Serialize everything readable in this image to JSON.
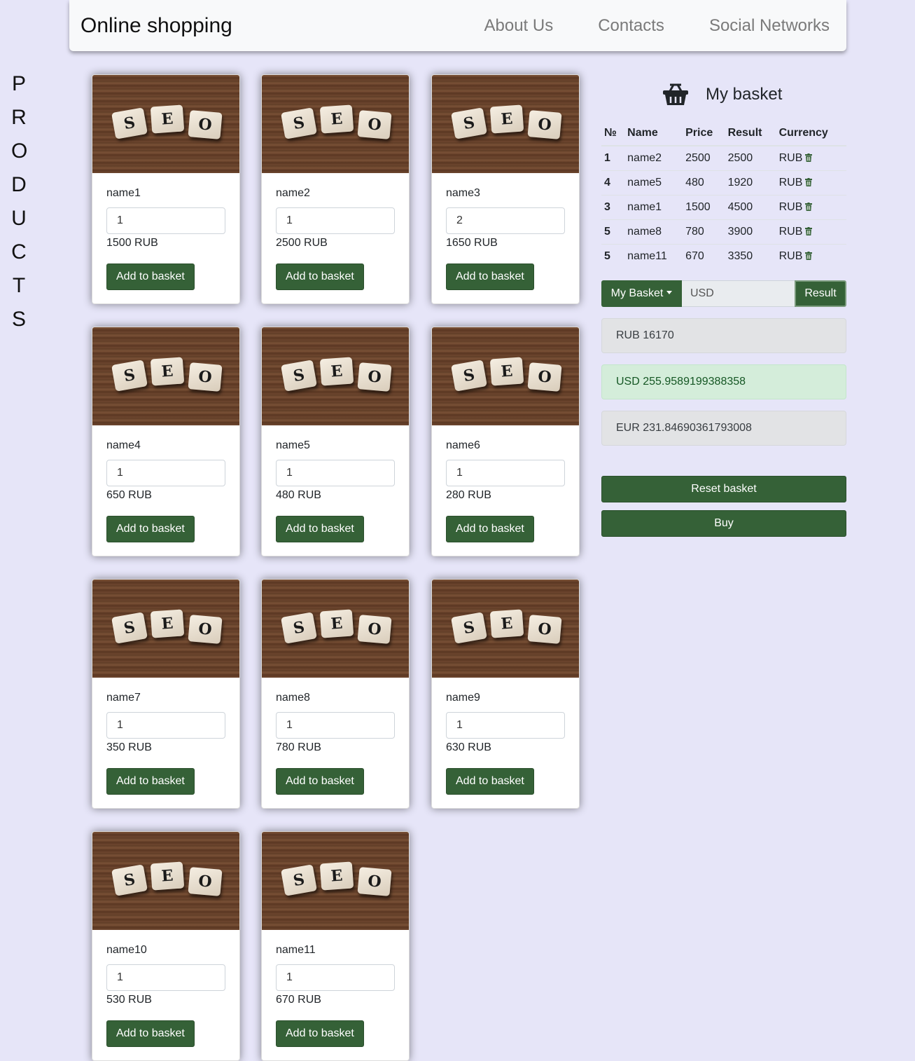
{
  "navbar": {
    "brand": "Online shopping",
    "links": [
      "About Us",
      "Contacts",
      "Social Networks"
    ]
  },
  "sidebar_title_letters": [
    "P",
    "R",
    "O",
    "D",
    "U",
    "C",
    "T",
    "S"
  ],
  "image_tiles": [
    "S",
    "E",
    "O"
  ],
  "products": [
    {
      "name": "name1",
      "qty": "1",
      "price": "1500 RUB",
      "button": "Add to basket"
    },
    {
      "name": "name2",
      "qty": "1",
      "price": "2500 RUB",
      "button": "Add to basket"
    },
    {
      "name": "name3",
      "qty": "2",
      "price": "1650 RUB",
      "button": "Add to basket"
    },
    {
      "name": "name4",
      "qty": "1",
      "price": "650 RUB",
      "button": "Add to basket"
    },
    {
      "name": "name5",
      "qty": "1",
      "price": "480 RUB",
      "button": "Add to basket"
    },
    {
      "name": "name6",
      "qty": "1",
      "price": "280 RUB",
      "button": "Add to basket"
    },
    {
      "name": "name7",
      "qty": "1",
      "price": "350 RUB",
      "button": "Add to basket"
    },
    {
      "name": "name8",
      "qty": "1",
      "price": "780 RUB",
      "button": "Add to basket"
    },
    {
      "name": "name9",
      "qty": "1",
      "price": "630 RUB",
      "button": "Add to basket"
    },
    {
      "name": "name10",
      "qty": "1",
      "price": "530 RUB",
      "button": "Add to basket"
    },
    {
      "name": "name11",
      "qty": "1",
      "price": "670 RUB",
      "button": "Add to basket"
    }
  ],
  "basket": {
    "title": "My basket",
    "icon": "basket-icon",
    "columns": [
      "№",
      "Name",
      "Price",
      "Result",
      "Currency"
    ],
    "rows": [
      {
        "num": "1",
        "name": "name2",
        "price": "2500",
        "result": "2500",
        "currency": "RUB"
      },
      {
        "num": "4",
        "name": "name5",
        "price": "480",
        "result": "1920",
        "currency": "RUB"
      },
      {
        "num": "3",
        "name": "name1",
        "price": "1500",
        "result": "4500",
        "currency": "RUB"
      },
      {
        "num": "5",
        "name": "name8",
        "price": "780",
        "result": "3900",
        "currency": "RUB"
      },
      {
        "num": "5",
        "name": "name11",
        "price": "670",
        "result": "3350",
        "currency": "RUB"
      }
    ],
    "dropdown_label": "My Basket",
    "currency_input": "USD",
    "result_button": "Result",
    "totals": {
      "rub": "RUB 16170",
      "usd": "USD 255.9589199388358",
      "eur": "EUR 231.84690361793008"
    },
    "reset_button": "Reset basket",
    "buy_button": "Buy"
  },
  "colors": {
    "background": "#e6e5f8",
    "accent_green": "#356137",
    "highlight_green": "#d4edda"
  }
}
